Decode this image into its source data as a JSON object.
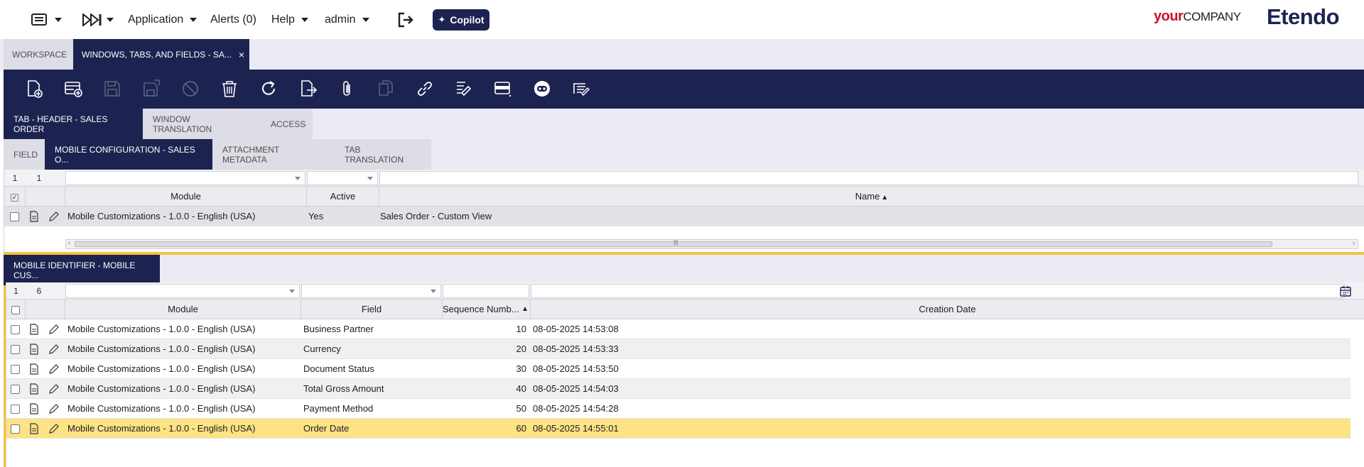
{
  "topbar": {
    "menu_items": [
      "Application",
      "Alerts (0)",
      "Help",
      "admin"
    ],
    "copilot_label": "Copilot",
    "logo_your": "your",
    "logo_company": "COMPANY",
    "logo_etendo": "Etendo"
  },
  "window_tabs": [
    {
      "label": "WORKSPACE",
      "active": false
    },
    {
      "label": "WINDOWS, TABS, AND FIELDS - SA...",
      "active": true,
      "close": "×"
    }
  ],
  "toolbar": {
    "icons": [
      "new-document-icon",
      "new-record-form-icon",
      "save-icon",
      "save-close-icon",
      "undo-icon",
      "delete-icon",
      "refresh-icon",
      "export-icon",
      "attachment-icon",
      "clone-icon",
      "link-icon",
      "process-icon",
      "grid-view-icon",
      "copilot-bot-icon",
      "notes-icon"
    ]
  },
  "tab_level1": [
    {
      "label": "TAB - HEADER - SALES ORDER",
      "active": true
    },
    {
      "label": "WINDOW TRANSLATION",
      "active": false
    },
    {
      "label": "ACCESS",
      "active": false
    }
  ],
  "tab_level2": [
    {
      "label": "FIELD",
      "active": false
    },
    {
      "label": "MOBILE CONFIGURATION - SALES O...",
      "active": true
    },
    {
      "label": "ATTACHMENT METADATA",
      "active": false
    },
    {
      "label": "TAB TRANSLATION",
      "active": false
    }
  ],
  "grid1": {
    "counter_selected": "1",
    "counter_total": "1",
    "columns": [
      "Module",
      "Active",
      "Name"
    ],
    "sort_indicator": "▲",
    "rows": [
      {
        "module": "Mobile Customizations - 1.0.0 - English (USA)",
        "active": "Yes",
        "name": "Sales Order - Custom View"
      }
    ]
  },
  "tab_level3": [
    {
      "label": "MOBILE IDENTIFIER - MOBILE CUS...",
      "active": true
    }
  ],
  "grid2": {
    "counter_selected": "1",
    "counter_total": "6",
    "columns": [
      "Module",
      "Field",
      "Sequence Numb...",
      "Creation Date"
    ],
    "sort_indicator": "▲",
    "rows": [
      {
        "module": "Mobile Customizations - 1.0.0 - English (USA)",
        "field": "Business Partner",
        "seq": "10",
        "date": "08-05-2025 14:53:08"
      },
      {
        "module": "Mobile Customizations - 1.0.0 - English (USA)",
        "field": "Currency",
        "seq": "20",
        "date": "08-05-2025 14:53:33"
      },
      {
        "module": "Mobile Customizations - 1.0.0 - English (USA)",
        "field": "Document Status",
        "seq": "30",
        "date": "08-05-2025 14:53:50"
      },
      {
        "module": "Mobile Customizations - 1.0.0 - English (USA)",
        "field": "Total Gross Amount",
        "seq": "40",
        "date": "08-05-2025 14:54:03"
      },
      {
        "module": "Mobile Customizations - 1.0.0 - English (USA)",
        "field": "Payment Method",
        "seq": "50",
        "date": "08-05-2025 14:54:28"
      },
      {
        "module": "Mobile Customizations - 1.0.0 - English (USA)",
        "field": "Order Date",
        "seq": "60",
        "date": "08-05-2025 14:55:01"
      }
    ],
    "selected_row": 5
  },
  "colors": {
    "brand_navy": "#1d2351",
    "selected_row": "#fde286",
    "accent_yellow": "#f5c342",
    "logo_red": "#c8102e"
  }
}
